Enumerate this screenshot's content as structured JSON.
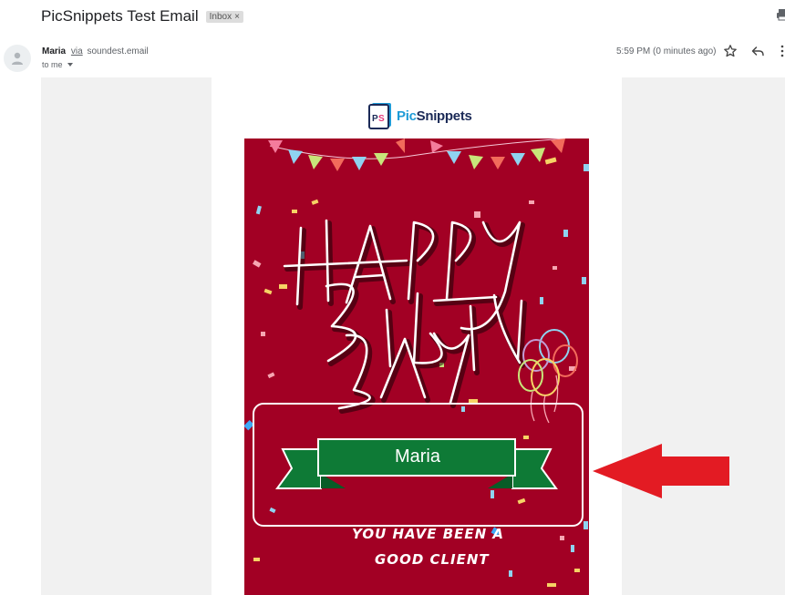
{
  "email": {
    "subject": "PicSnippets Test Email",
    "label": "Inbox",
    "label_remove": "×",
    "sender_name": "Maria",
    "sender_via": "via",
    "sender_domain": "soundest.email",
    "recipient": "to me",
    "timestamp": "5:59 PM (0 minutes ago)"
  },
  "icons": {
    "print": "print-icon",
    "avatar": "person-icon",
    "star": "star-icon",
    "reply": "reply-icon",
    "more": "more-vert-icon"
  },
  "content": {
    "logo": {
      "part1": "Pic",
      "part2": "Snippets"
    },
    "card": {
      "headline_graphic": "HAPPY BIRTHDAY",
      "ribbon_name": "Maria",
      "message_line1": "YOU HAVE BEEN A",
      "message_line2": "GOOD CLIENT"
    }
  },
  "colors": {
    "card_background": "#a20024",
    "ribbon": "#0e7a36",
    "arrow": "#e31b23",
    "logo_blue": "#1e9bd7",
    "logo_navy": "#1b2a57"
  }
}
